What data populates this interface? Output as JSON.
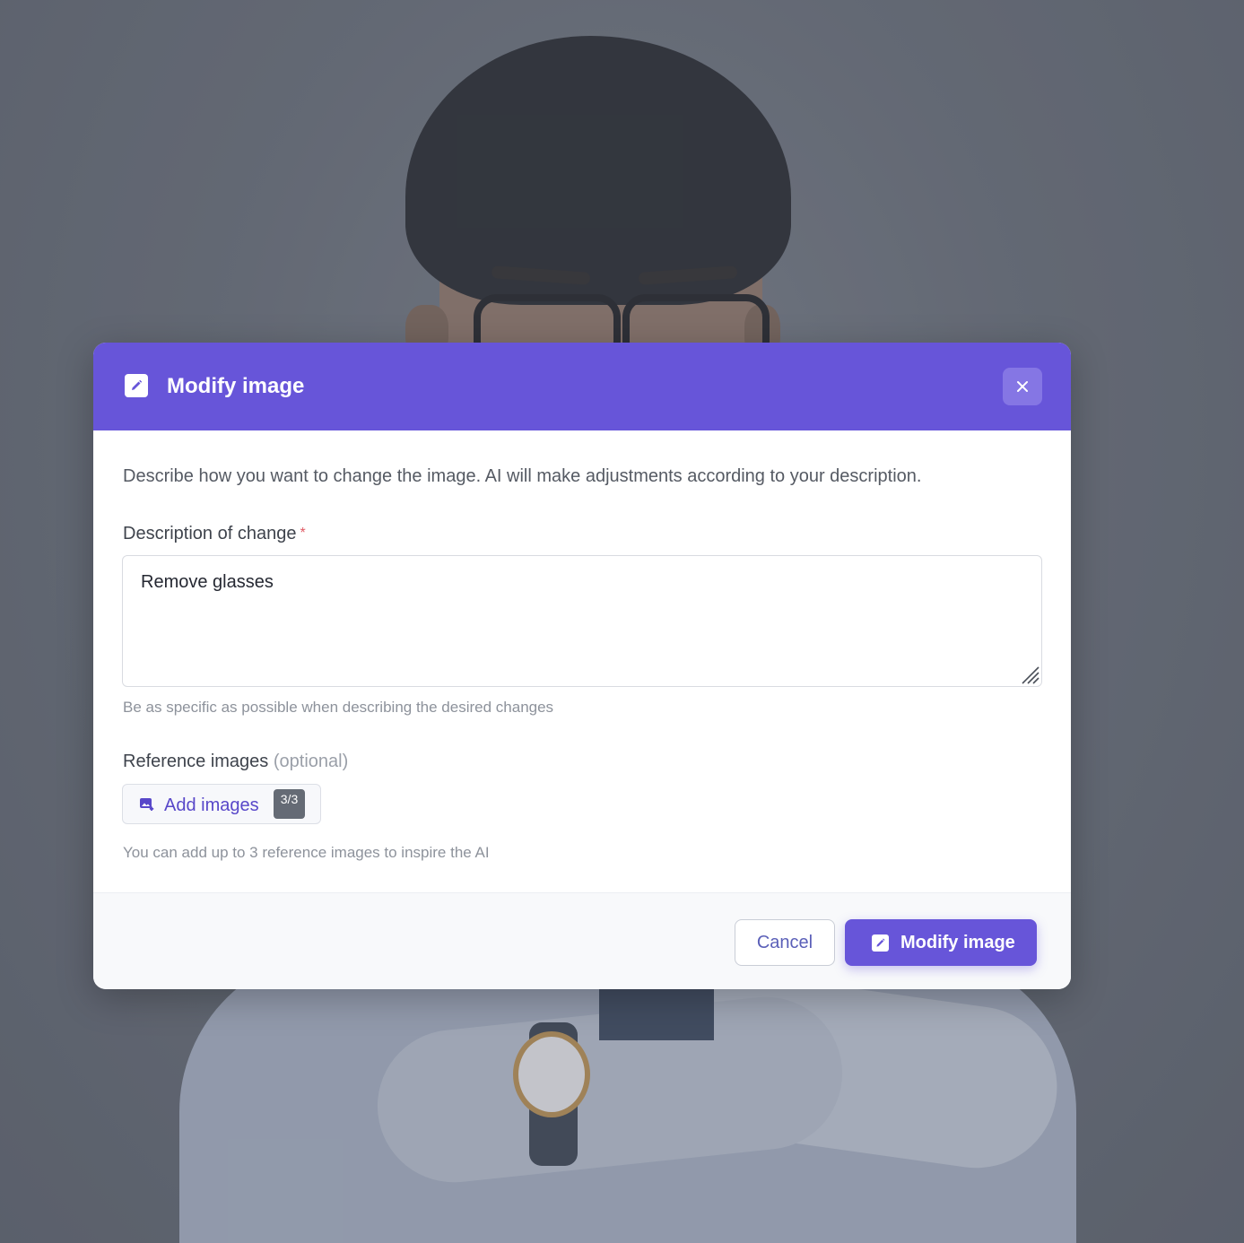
{
  "background": {
    "description_icon": "portrait-photo"
  },
  "modal": {
    "title": "Modify image",
    "header_icon": "edit-icon",
    "close_icon": "close-icon",
    "intro": "Describe how you want to change the image. AI will make adjustments according to your description.",
    "description_field": {
      "label": "Description of change",
      "required_marker": "*",
      "value": "Remove glasses",
      "helper": "Be as specific as possible when describing the desired changes"
    },
    "reference_images": {
      "label": "Reference images",
      "optional_note": "(optional)",
      "button_label": "Add images",
      "button_icon": "add-image-icon",
      "count_badge": "3/3",
      "helper": "You can add up to 3 reference images to inspire the AI"
    },
    "footer": {
      "cancel_label": "Cancel",
      "submit_label": "Modify image",
      "submit_icon": "edit-icon"
    }
  },
  "colors": {
    "accent": "#6755d9",
    "accent_light": "#8576e4",
    "required": "#e05a64",
    "badge": "#656b75"
  }
}
